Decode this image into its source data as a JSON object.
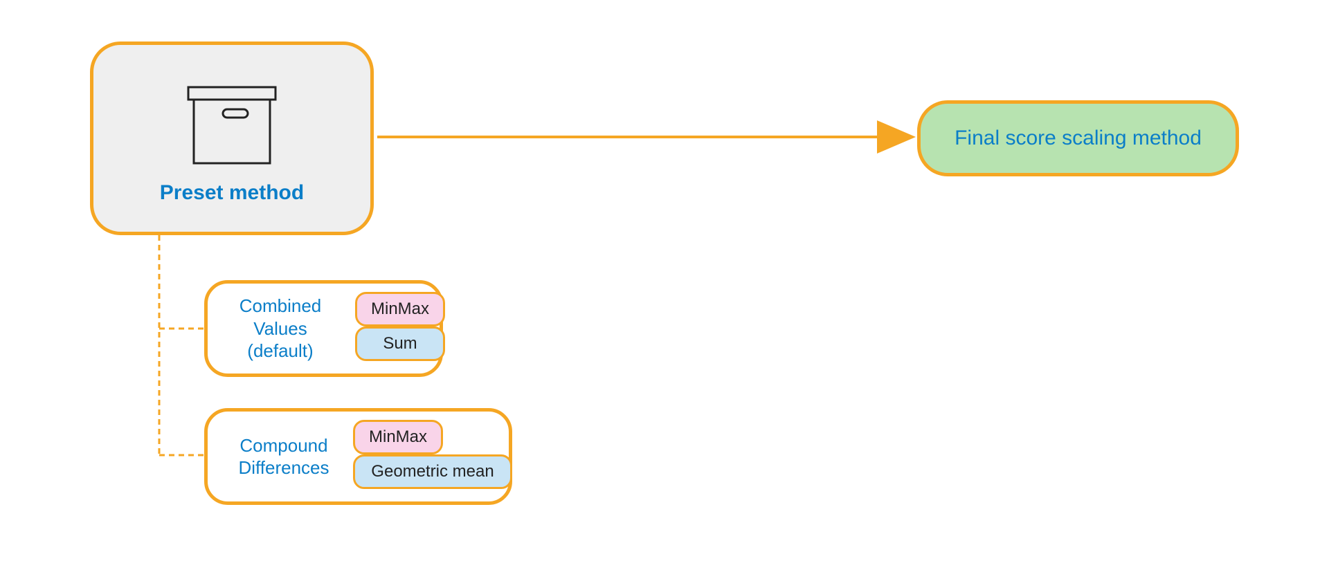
{
  "colors": {
    "border": "#F5A623",
    "text_link": "#0B7EC8",
    "pink": "#F9D4E9",
    "blue": "#C9E4F5",
    "green": "#B7E3B0",
    "grey": "#EFEFEF"
  },
  "preset": {
    "title": "Preset method",
    "icon": "archive-box-icon"
  },
  "final": {
    "title": "Final score scaling method"
  },
  "children": [
    {
      "label": "Combined Values (default)",
      "label_lines": [
        "Combined",
        "Values",
        "(default)"
      ],
      "tags": [
        {
          "text": "MinMax",
          "kind": "pink"
        },
        {
          "text": "Sum",
          "kind": "blue"
        }
      ]
    },
    {
      "label": "Compound Differences",
      "label_lines": [
        "Compound",
        "Differences"
      ],
      "tags": [
        {
          "text": "MinMax",
          "kind": "pink"
        },
        {
          "text": "Geometric mean",
          "kind": "blue"
        }
      ]
    }
  ]
}
